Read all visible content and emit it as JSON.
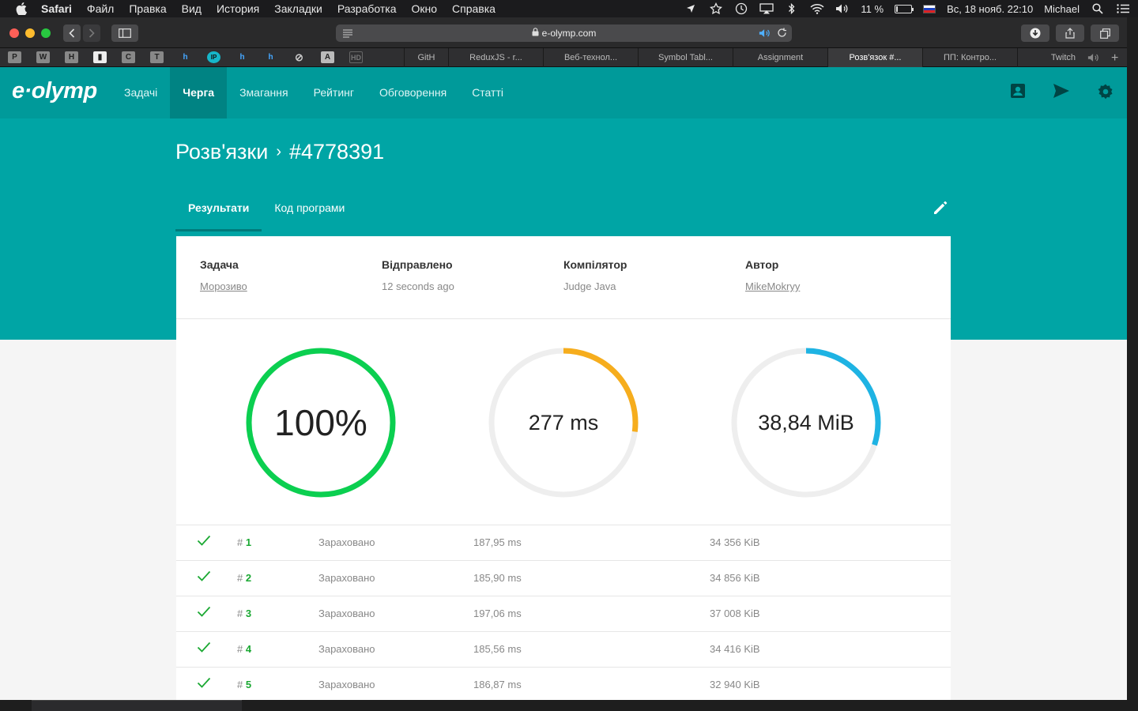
{
  "menubar": {
    "items": [
      "Safari",
      "Файл",
      "Правка",
      "Вид",
      "История",
      "Закладки",
      "Разработка",
      "Окно",
      "Справка"
    ],
    "battery": "11 %",
    "battery_level": 0.11,
    "datetime": "Вс, 18 нояб.  22:10",
    "user": "Michael"
  },
  "browser": {
    "url": "e-olymp.com",
    "favorites": [
      "P",
      "W",
      "H",
      "▮",
      "C",
      "T",
      "h",
      "IP",
      "h",
      "h",
      "⊘",
      "A",
      "HD"
    ],
    "tabs": [
      "GitH",
      "ReduxJS - r...",
      "Веб-технол...",
      "Symbol Tabl...",
      "Assignment",
      "Розв'язок #...",
      "ПП: Контро...",
      "Twitch"
    ],
    "active_tab_index": 5
  },
  "site": {
    "logo": "e·olymp",
    "nav": [
      "Задачі",
      "Черга",
      "Змагання",
      "Рейтинг",
      "Обговорення",
      "Статті"
    ],
    "active_nav_index": 1,
    "breadcrumb": {
      "section": "Розв'язки",
      "id": "#4778391"
    },
    "subtabs": [
      "Результати",
      "Код програми"
    ],
    "active_subtab_index": 0
  },
  "submission": {
    "task_label": "Задача",
    "task_value": "Морозиво",
    "sent_label": "Відправлено",
    "sent_value": "12 seconds ago",
    "compiler_label": "Компілятор",
    "compiler_value": "Judge Java",
    "author_label": "Автор",
    "author_value": "MikeMokryy"
  },
  "gauges": [
    {
      "text": "100%",
      "fraction": 1.0,
      "color": "#0bcf50"
    },
    {
      "text": "277 ms",
      "fraction": 0.27,
      "color": "#f6ad1d"
    },
    {
      "text": "38,84 MiB",
      "fraction": 0.3,
      "color": "#1eb3e3"
    }
  ],
  "tests": [
    {
      "hash": "# ",
      "num": "1",
      "status": "Зараховано",
      "time": "187,95 ms",
      "memory": "34 356 KiB"
    },
    {
      "hash": "# ",
      "num": "2",
      "status": "Зараховано",
      "time": "185,90 ms",
      "memory": "34 856 KiB"
    },
    {
      "hash": "# ",
      "num": "3",
      "status": "Зараховано",
      "time": "197,06 ms",
      "memory": "37 008 KiB"
    },
    {
      "hash": "# ",
      "num": "4",
      "status": "Зараховано",
      "time": "185,56 ms",
      "memory": "34 416 KiB"
    },
    {
      "hash": "# ",
      "num": "5",
      "status": "Зараховано",
      "time": "186,87 ms",
      "memory": "32 940 KiB"
    }
  ],
  "colors": {
    "header": "#009a9a",
    "hero": "#00a5a5",
    "accept": "#1aa832"
  }
}
